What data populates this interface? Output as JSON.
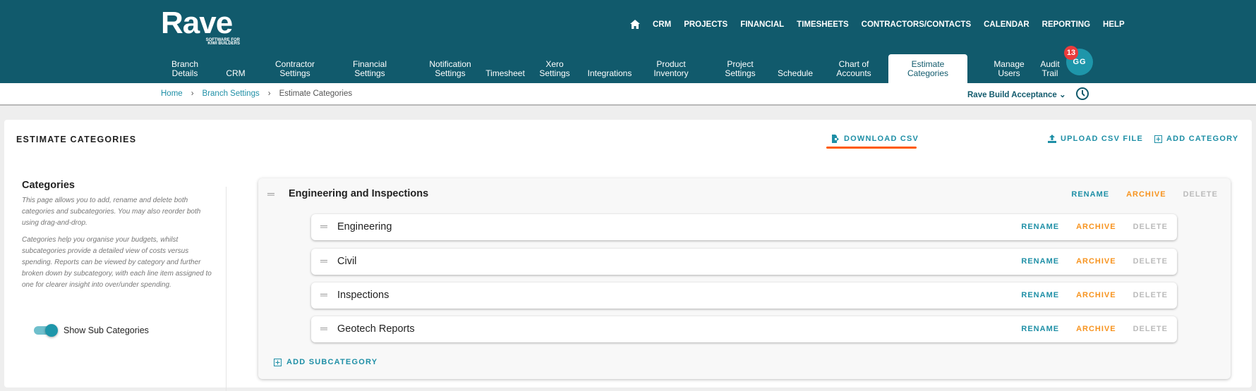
{
  "logo": {
    "name": "Rave",
    "tagline_1": "SOFTWARE FOR",
    "tagline_2": "KIWI BUILDERS"
  },
  "top_nav": [
    "CRM",
    "PROJECTS",
    "FINANCIAL",
    "TIMESHEETS",
    "CONTRACTORS/CONTACTS",
    "CALENDAR",
    "REPORTING",
    "HELP"
  ],
  "settings_tabs": [
    {
      "l1": "Branch",
      "l2": "Details"
    },
    {
      "l1": "",
      "l2": "CRM"
    },
    {
      "l1": "Contractor",
      "l2": "Settings"
    },
    {
      "l1": "Financial",
      "l2": "Settings"
    },
    {
      "l1": "Notification",
      "l2": "Settings"
    },
    {
      "l1": "",
      "l2": "Timesheet"
    },
    {
      "l1": "Xero",
      "l2": "Settings"
    },
    {
      "l1": "",
      "l2": "Integrations"
    },
    {
      "l1": "Product",
      "l2": "Inventory"
    },
    {
      "l1": "Project",
      "l2": "Settings"
    },
    {
      "l1": "",
      "l2": "Schedule"
    },
    {
      "l1": "Chart of",
      "l2": "Accounts"
    },
    {
      "l1": "Estimate",
      "l2": "Categories"
    },
    {
      "l1": "Manage",
      "l2": "Users"
    },
    {
      "l1": "Audit",
      "l2": "Trail"
    }
  ],
  "user": {
    "initials": "GG",
    "notifications": "13"
  },
  "breadcrumb": [
    "Home",
    "Branch Settings",
    "Estimate Categories"
  ],
  "organisation": "Rave Build Acceptance",
  "page": {
    "title": "ESTIMATE CATEGORIES",
    "download": "DOWNLOAD CSV",
    "upload": "UPLOAD CSV FILE",
    "add_category": "ADD CATEGORY"
  },
  "info": {
    "heading": "Categories",
    "p1": "This page allows you to add, rename and delete both categories and subcategories. You may also reorder both using drag-and-drop.",
    "p2": "Categories help you organise your budgets, whilst subcategories provide a detailed view of costs versus spending. Reports can be viewed by category and further broken down by subcategory, with each line item assigned to one for clearer insight into over/under spending.",
    "toggle_label": "Show Sub Categories",
    "toggle_on": true
  },
  "actions": {
    "rename": "RENAME",
    "archive": "ARCHIVE",
    "delete": "DELETE"
  },
  "category": {
    "name": "Engineering and Inspections",
    "subcategories": [
      "Engineering",
      "Civil",
      "Inspections",
      "Geotech Reports"
    ],
    "add_sub": "ADD SUBCATEGORY"
  },
  "colors": {
    "header": "#115a6c",
    "accent": "#1e8fa6",
    "archive": "#f7931e",
    "highlight": "#ff5a00"
  }
}
